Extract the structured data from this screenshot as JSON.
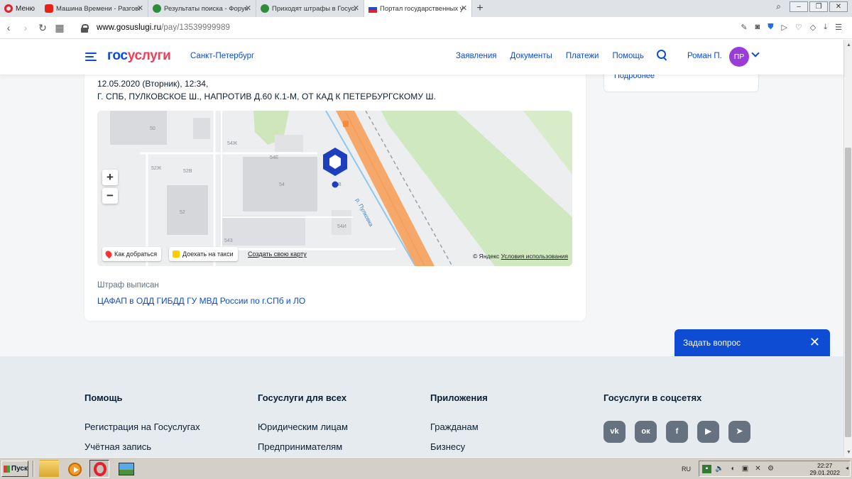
{
  "browser": {
    "menu_label": "Меню",
    "tabs": [
      {
        "title": "Машина Времени - Разговор",
        "icon": "youtube-icon"
      },
      {
        "title": "Результаты поиска - Форум",
        "icon": "forum-icon"
      },
      {
        "title": "Приходят штрафы в Госуслу",
        "icon": "forum-icon"
      },
      {
        "title": "Портал государственных ус",
        "icon": "russia-flag-icon"
      }
    ],
    "new_tab": "+",
    "url_host": "www.gosuslugi.ru",
    "url_path": "/pay/13539999989"
  },
  "header": {
    "logo_part1": "гос",
    "logo_part2": "услуги",
    "region": "Санкт-Петербург",
    "nav": [
      "Заявления",
      "Документы",
      "Платежи",
      "Помощь"
    ],
    "user_name": "Роман П.",
    "avatar_initials": "ПР"
  },
  "fine": {
    "datetime": "12.05.2020 (Вторник), 12:34,",
    "location": "Г. СПБ, ПУЛКОВСКОЕ Ш., НАПРОТИВ Д.60 К.1-М, ОТ КАД К ПЕТЕРБУРГСКОМУ Ш.",
    "issued_label": "Штраф выписан",
    "issued_by": "ЦАФАП в ОДД ГИБДД ГУ МВД России по г.СПб и ЛО"
  },
  "side": {
    "more_link": "Подробнее"
  },
  "map": {
    "zoom_in": "+",
    "zoom_out": "−",
    "route_button": "Как добраться",
    "taxi_button": "Доехать на такси",
    "create_map": "Создать свою карту",
    "copyright": "© Яндекс",
    "terms": "Условия использования",
    "labels": {
      "b50": "50",
      "b54zh": "54Ж",
      "b54e": "54Е",
      "b52zh": "52Ж",
      "b52v": "52В",
      "b54": "54",
      "b52": "52",
      "b54i": "54И",
      "b543": "543",
      "bB": "В",
      "road": "р. Пулковка"
    }
  },
  "chat": {
    "label": "Задать вопрос",
    "close": "✕"
  },
  "footer": {
    "columns": [
      {
        "title": "Помощь",
        "links": [
          "Регистрация на Госуслугах",
          "Учётная запись"
        ]
      },
      {
        "title": "Госуслуги для всех",
        "links": [
          "Юридическим лицам",
          "Предпринимателям"
        ]
      },
      {
        "title": "Приложения",
        "links": [
          "Гражданам",
          "Бизнесу"
        ]
      }
    ],
    "social_title": "Госуслуги в соцсетях",
    "socials": [
      {
        "name": "vk-icon",
        "glyph": "vk"
      },
      {
        "name": "odnoklassniki-icon",
        "glyph": "ок"
      },
      {
        "name": "facebook-icon",
        "glyph": "f"
      },
      {
        "name": "youtube-icon",
        "glyph": "▶"
      },
      {
        "name": "telegram-icon",
        "glyph": "➤"
      }
    ]
  },
  "taskbar": {
    "start": "Пуск",
    "lang": "RU",
    "time": "22:27",
    "date": "29.01.2022"
  },
  "colors": {
    "brand_blue": "#0d4cd3",
    "brand_red": "#ee3f58",
    "avatar": "#9b3bd8",
    "footer_bg": "#e6ebef"
  }
}
